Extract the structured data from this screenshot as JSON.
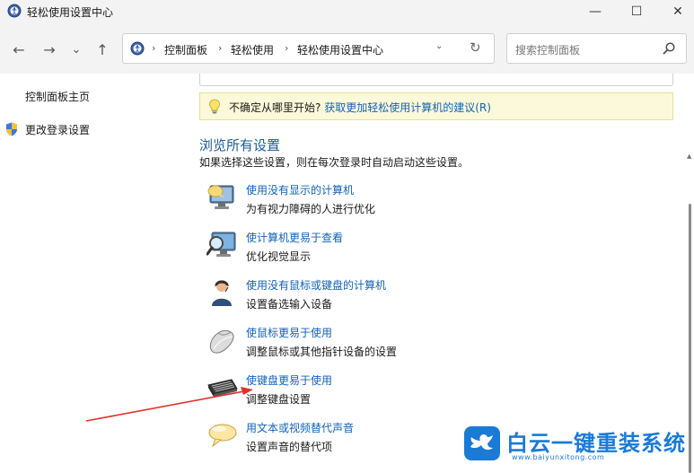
{
  "window": {
    "title": "轻松使用设置中心",
    "minimize": "—",
    "maximize": "☐",
    "close": "✕"
  },
  "nav": {
    "back": "←",
    "forward": "→",
    "dropdown": "⌄",
    "up": "↑"
  },
  "breadcrumb": {
    "items": [
      "控制面板",
      "轻松使用",
      "轻松使用设置中心"
    ],
    "separator": "›"
  },
  "search": {
    "placeholder": "搜索控制面板"
  },
  "sidebar": {
    "items": [
      {
        "label": "控制面板主页"
      },
      {
        "label": "更改登录设置"
      }
    ]
  },
  "tip": {
    "prefix": "不确定从哪里开始?",
    "link": "获取更加轻松使用计算机的建议(R)"
  },
  "browse": {
    "title": "浏览所有设置",
    "description": "如果选择这些设置，则在每次登录时自动启动这些设置。"
  },
  "settings": [
    {
      "link": "使用没有显示的计算机",
      "desc": "为有视力障碍的人进行优化",
      "icon": "monitor-speaker-icon"
    },
    {
      "link": "使计算机更易于查看",
      "desc": "优化视觉显示",
      "icon": "magnifier-monitor-icon"
    },
    {
      "link": "使用没有鼠标或键盘的计算机",
      "desc": "设置备选输入设备",
      "icon": "person-headset-icon"
    },
    {
      "link": "使鼠标更易于使用",
      "desc": "调整鼠标或其他指针设备的设置",
      "icon": "mouse-icon"
    },
    {
      "link": "使键盘更易于使用",
      "desc": "调整键盘设置",
      "icon": "keyboard-icon"
    },
    {
      "link": "用文本或视频替代声音",
      "desc": "设置声音的替代项",
      "icon": "speech-bubble-icon"
    }
  ],
  "watermark": {
    "title": "白云一键重装系统",
    "url": "www.baiyunxitong.com"
  },
  "colors": {
    "link": "#1262b5",
    "heading": "#1e5a94",
    "tip_bg": "#fbf9d9",
    "annotation_arrow": "#e0322a",
    "watermark": "#1a7ad6"
  }
}
